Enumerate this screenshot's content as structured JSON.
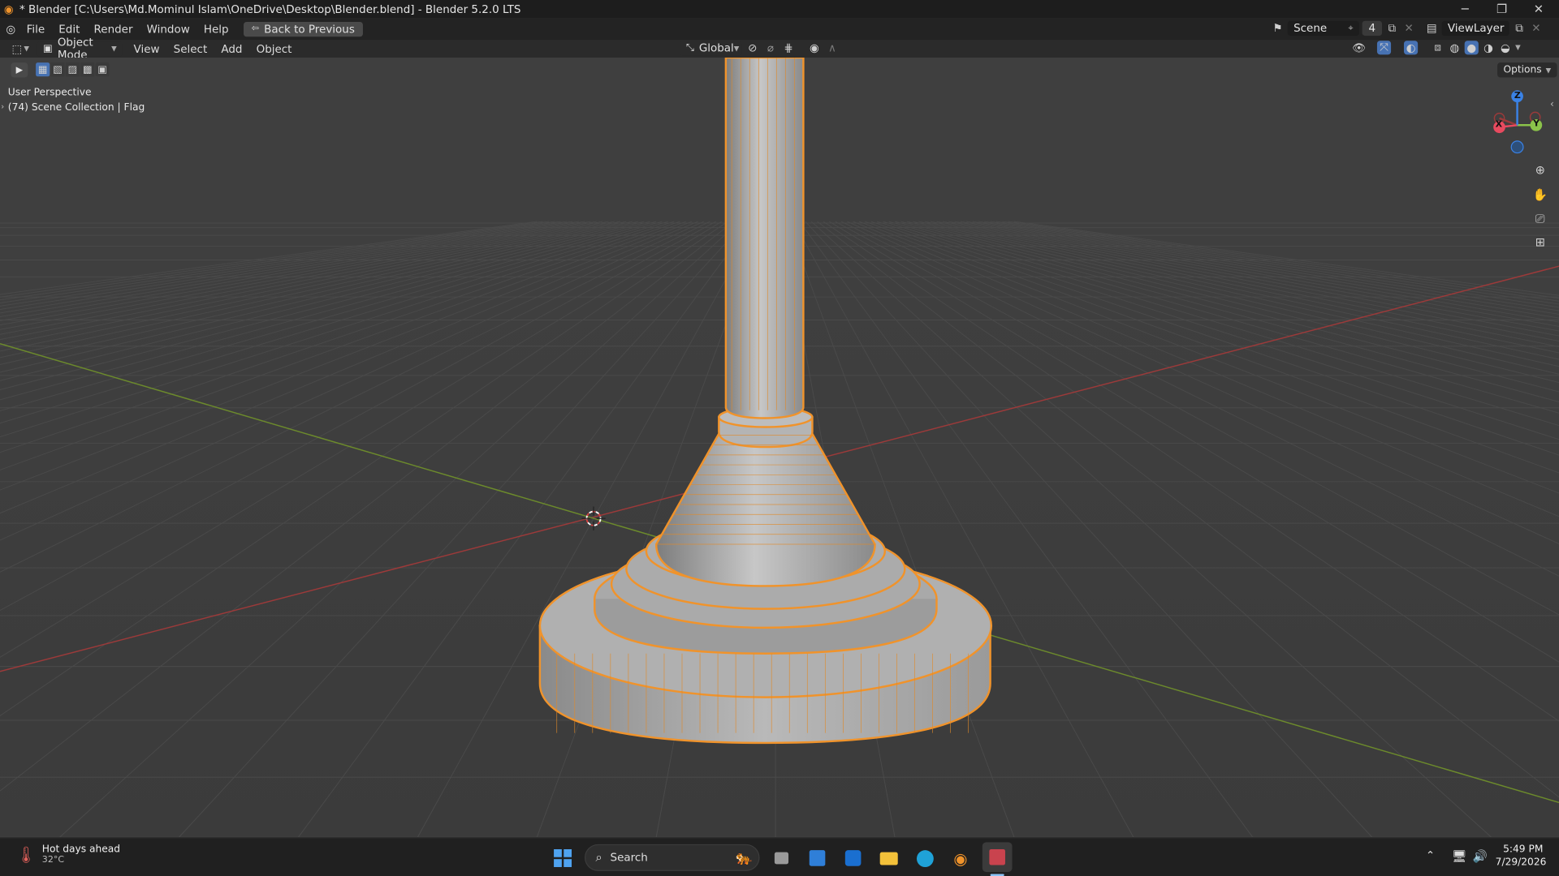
{
  "window": {
    "title": "* Blender [C:\\Users\\Md.Mominul Islam\\OneDrive\\Desktop\\Blender.blend] - Blender 5.2.0 LTS",
    "minimize_icon": "minimize-icon",
    "maximize_icon": "restore-icon",
    "close_icon": "close-icon"
  },
  "menubar": {
    "items": [
      "File",
      "Edit",
      "Render",
      "Window",
      "Help"
    ],
    "back_button": "Back to Previous",
    "scene_label": "Scene",
    "scene_count": "4",
    "viewlayer_label": "ViewLayer"
  },
  "header": {
    "mode": "Object Mode",
    "menus": [
      "View",
      "Select",
      "Add",
      "Object"
    ],
    "transform_orientation": "Global",
    "options": "Options"
  },
  "viewport": {
    "perspective": "User Perspective",
    "collection": "(74) Scene Collection | Flag",
    "gizmo": {
      "x": "X",
      "y": "Y",
      "z": "Z",
      "x_color": "#e84a5f",
      "y_color": "#8bc34a",
      "z_color": "#3a82e6"
    },
    "selection_color": "#f0932b"
  },
  "taskbar": {
    "weather_title": "Hot days ahead",
    "weather_temp": "32°C",
    "search": "Search",
    "time": "5:49 PM",
    "date": "7/29/2026"
  }
}
